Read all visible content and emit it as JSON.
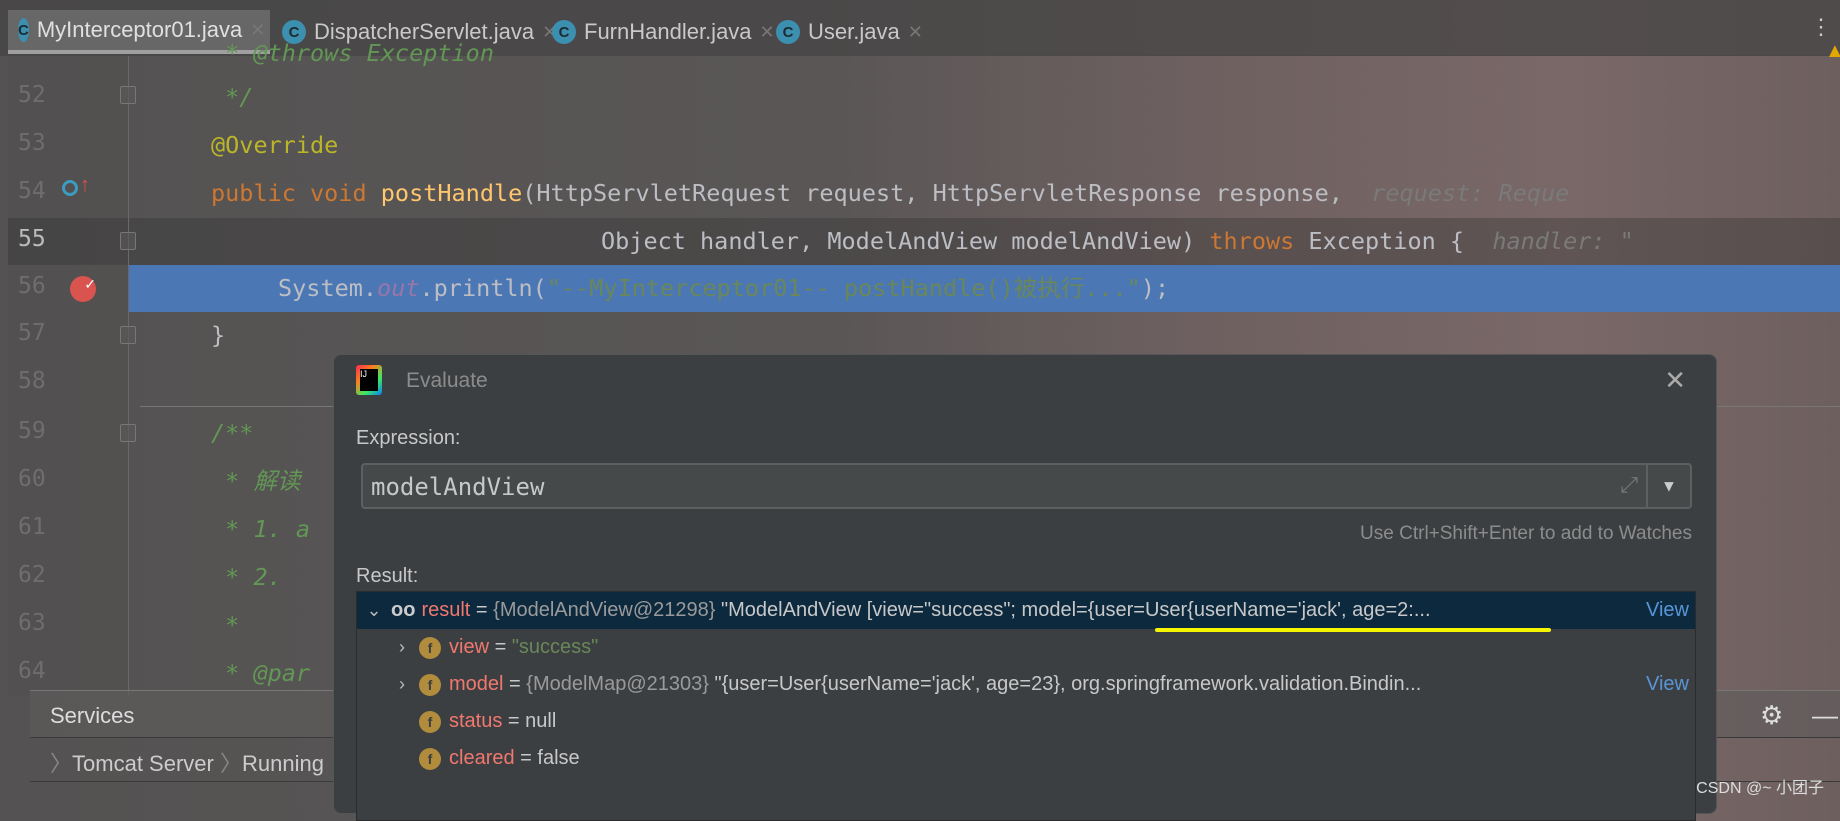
{
  "tabs": [
    {
      "label": "MyInterceptor01.java",
      "active": true
    },
    {
      "label": "DispatcherServlet.java"
    },
    {
      "label": "FurnHandler.java"
    },
    {
      "label": "User.java"
    }
  ],
  "editor": {
    "line_numbers": [
      "52",
      "53",
      "54",
      "55",
      "56",
      "57",
      "58",
      "59",
      "60",
      "61",
      "62",
      "63",
      "64"
    ],
    "current_line": "55",
    "lines": {
      "l51": " * @throws Exception",
      "l52": " */",
      "l53": "@Override",
      "l54_kw": "public void ",
      "l54_fn": "postHandle",
      "l54_rest": "(HttpServletRequest request, HttpServletResponse response,",
      "l54_hint": "request: Reque",
      "l55_a": "Object handler, ModelAndView modelAndView) ",
      "l55_kw": "throws",
      "l55_b": " Exception {",
      "l55_hint": "handler: \"",
      "l56_a": "System.",
      "l56_fld": "out",
      "l56_b": ".println(",
      "l56_str": "\"--MyInterceptor01-- postHandle()被执行...\"",
      "l56_c": ");",
      "l57": "}",
      "l59": "/**",
      "l60": " * 解读",
      "l61": " * 1. a",
      "l62": " * 2.",
      "l63": " *",
      "l64": " * @par"
    }
  },
  "services": {
    "title": "Services",
    "breadcrumb": [
      "Tomcat Server",
      "Running"
    ]
  },
  "evaluate": {
    "title": "Evaluate",
    "expression_label": "Expression:",
    "expression_value": "modelAndView",
    "hint": "Use Ctrl+Shift+Enter to add to Watches",
    "result_label": "Result:",
    "rows": [
      {
        "name": "result",
        "type": "{ModelAndView@21298}",
        "value": "\"ModelAndView [view=\"success\"; model={user=User{userName='jack', age=2:...",
        "link": "View",
        "expanded": true,
        "icon": "watch-glasses-icon"
      },
      {
        "name": "view",
        "value": "\"success\"",
        "icon": "field-icon"
      },
      {
        "name": "model",
        "type": "{ModelMap@21303}",
        "value": "\"{user=User{userName='jack', age=23}, org.springframework.validation.Bindin...",
        "link": "View",
        "icon": "field-icon"
      },
      {
        "name": "status",
        "value": "null",
        "icon": "field-icon"
      },
      {
        "name": "cleared",
        "value": "false",
        "icon": "field-icon"
      }
    ]
  },
  "watermark": "CSDN @~ 小团子",
  "colors": {
    "breakpoint_line": "#4b77b4",
    "selected_row": "#0d293e",
    "underline": "#f5f500",
    "keyword": "#cc7832",
    "string": "#6a8759"
  }
}
